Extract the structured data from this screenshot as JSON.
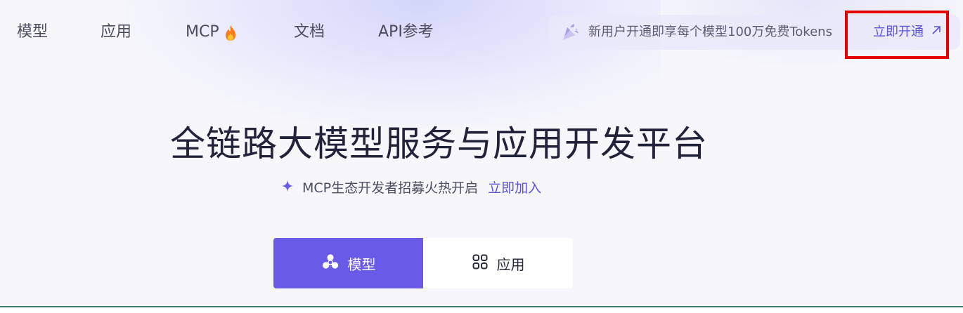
{
  "nav": {
    "items": [
      {
        "label": "模型"
      },
      {
        "label": "应用"
      },
      {
        "label": "MCP",
        "icon": "fire-icon"
      },
      {
        "label": "文档"
      },
      {
        "label": "API参考"
      }
    ]
  },
  "promo": {
    "icon": "confetti-icon",
    "text": "新用户开通即享每个模型100万免费Tokens",
    "link_label": "立即开通",
    "link_icon": "arrow-up-right-icon"
  },
  "hero": {
    "title": "全链路大模型服务与应用开发平台",
    "subtitle_icon": "sparkle-icon",
    "subtitle": "MCP生态开发者招募火热开启",
    "subtitle_link": "立即加入"
  },
  "segment": {
    "active": {
      "label": "模型",
      "icon": "model-icon"
    },
    "inactive": {
      "label": "应用",
      "icon": "grid-icon"
    }
  },
  "colors": {
    "accent": "#6a5ae8",
    "link": "#5a52d8",
    "highlight": "#e50000",
    "background": "#f6f6fb"
  }
}
